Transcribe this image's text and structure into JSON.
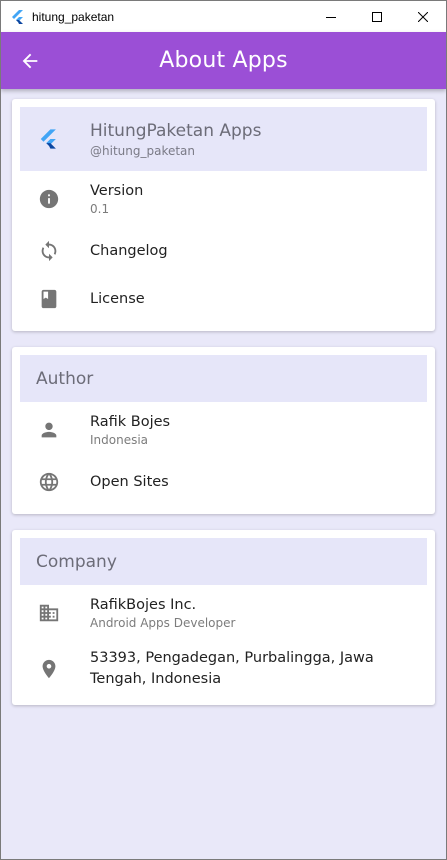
{
  "window": {
    "title": "hitung_paketan"
  },
  "appbar": {
    "title": "About Apps"
  },
  "app_card": {
    "name": "HitungPaketan Apps",
    "handle": "@hitung_paketan",
    "items": [
      {
        "label": "Version",
        "sub": "0.1",
        "icon": "info-icon"
      },
      {
        "label": "Changelog",
        "icon": "sync-icon"
      },
      {
        "label": "License",
        "icon": "book-icon"
      }
    ]
  },
  "author_card": {
    "header": "Author",
    "items": [
      {
        "label": "Rafik Bojes",
        "sub": "Indonesia",
        "icon": "person-icon"
      },
      {
        "label": "Open Sites",
        "icon": "globe-icon"
      }
    ]
  },
  "company_card": {
    "header": "Company",
    "items": [
      {
        "label": "RafikBojes Inc.",
        "sub": "Android Apps Developer",
        "icon": "business-icon"
      },
      {
        "label": "53393, Pengadegan, Purbalingga, Jawa Tengah, Indonesia",
        "icon": "location-pin-icon"
      }
    ]
  },
  "colors": {
    "appbar": "#9b4fd6",
    "header_bg": "#e6e6f9",
    "background": "#e9e8f9",
    "icon": "#757575"
  }
}
